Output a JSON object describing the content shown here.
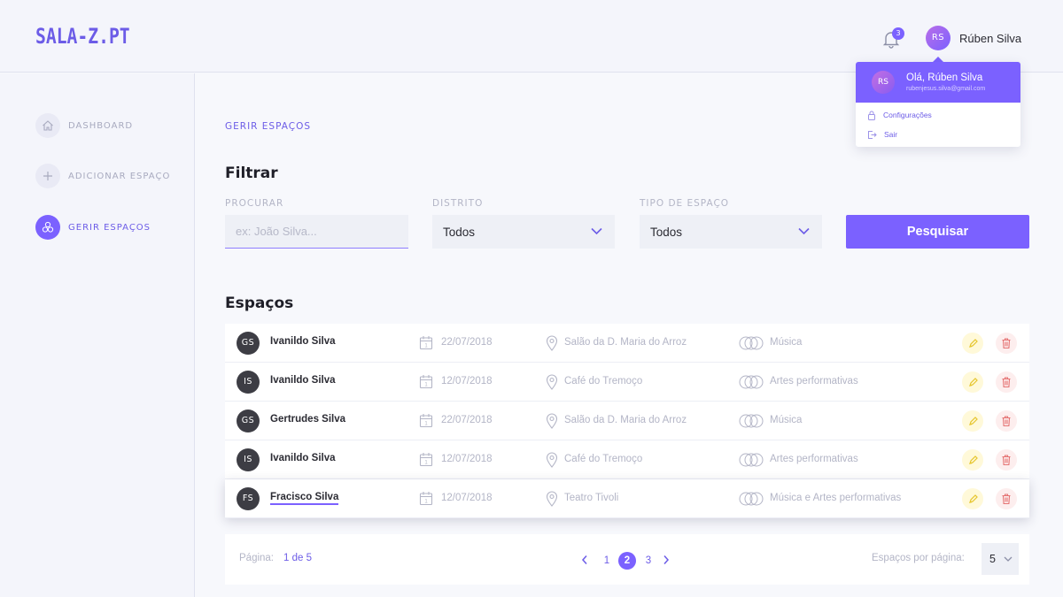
{
  "app": {
    "logo": "SALA-Z.PT"
  },
  "header": {
    "notifications_count": "3",
    "user_initials": "RS",
    "user_name": "Rúben Silva"
  },
  "user_menu": {
    "initials": "RS",
    "greeting": "Olá, Rúben Silva",
    "email": "rubenjesus.silva@gmail.com",
    "items": [
      {
        "label": "Configurações",
        "icon": "lock-icon"
      },
      {
        "label": "Sair",
        "icon": "logout-icon"
      }
    ]
  },
  "sidebar": {
    "items": [
      {
        "label": "DASHBOARD",
        "icon": "home-icon",
        "active": false
      },
      {
        "label": "ADICIONAR ESPAÇO",
        "icon": "plus-icon",
        "active": false
      },
      {
        "label": "GERIR ESPAÇOS",
        "icon": "spaces-icon",
        "active": true
      }
    ]
  },
  "main": {
    "breadcrumb": "GERIR ESPAÇOS",
    "filter_title": "Filtrar",
    "filters": {
      "search_label": "PROCURAR",
      "search_placeholder": "ex: João Silva...",
      "district_label": "DISTRITO",
      "district_value": "Todos",
      "type_label": "TIPO DE ESPAÇO",
      "type_value": "Todos",
      "search_button": "Pesquisar"
    },
    "list_title": "Espaços",
    "rows": [
      {
        "initials": "GS",
        "name": "Ivanildo Silva",
        "date": "22/07/2018",
        "location": "Salão da D. Maria do Arroz",
        "type": "Música"
      },
      {
        "initials": "IS",
        "name": "Ivanildo Silva",
        "date": "12/07/2018",
        "location": "Café do Tremoço",
        "type": "Artes performativas"
      },
      {
        "initials": "GS",
        "name": "Gertrudes Silva",
        "date": "22/07/2018",
        "location": "Salão da D. Maria do Arroz",
        "type": "Música"
      },
      {
        "initials": "IS",
        "name": "Ivanildo Silva",
        "date": "12/07/2018",
        "location": "Café do Tremoço",
        "type": "Artes performativas"
      },
      {
        "initials": "FS",
        "name": "Fracisco Silva",
        "date": "12/07/2018",
        "location": "Teatro Tivoli",
        "type": "Música e Artes performativas"
      }
    ],
    "pagination": {
      "page_label": "Página:",
      "page_value": "1 de 5",
      "pages": [
        "1",
        "2",
        "3"
      ],
      "current": "2",
      "per_page_label": "Espaços por página:",
      "per_page_value": "5"
    }
  },
  "colors": {
    "accent": "#7b61ff",
    "edit_bg": "#fff9d9",
    "delete_bg": "#fdeeee",
    "delete": "#e57373"
  }
}
